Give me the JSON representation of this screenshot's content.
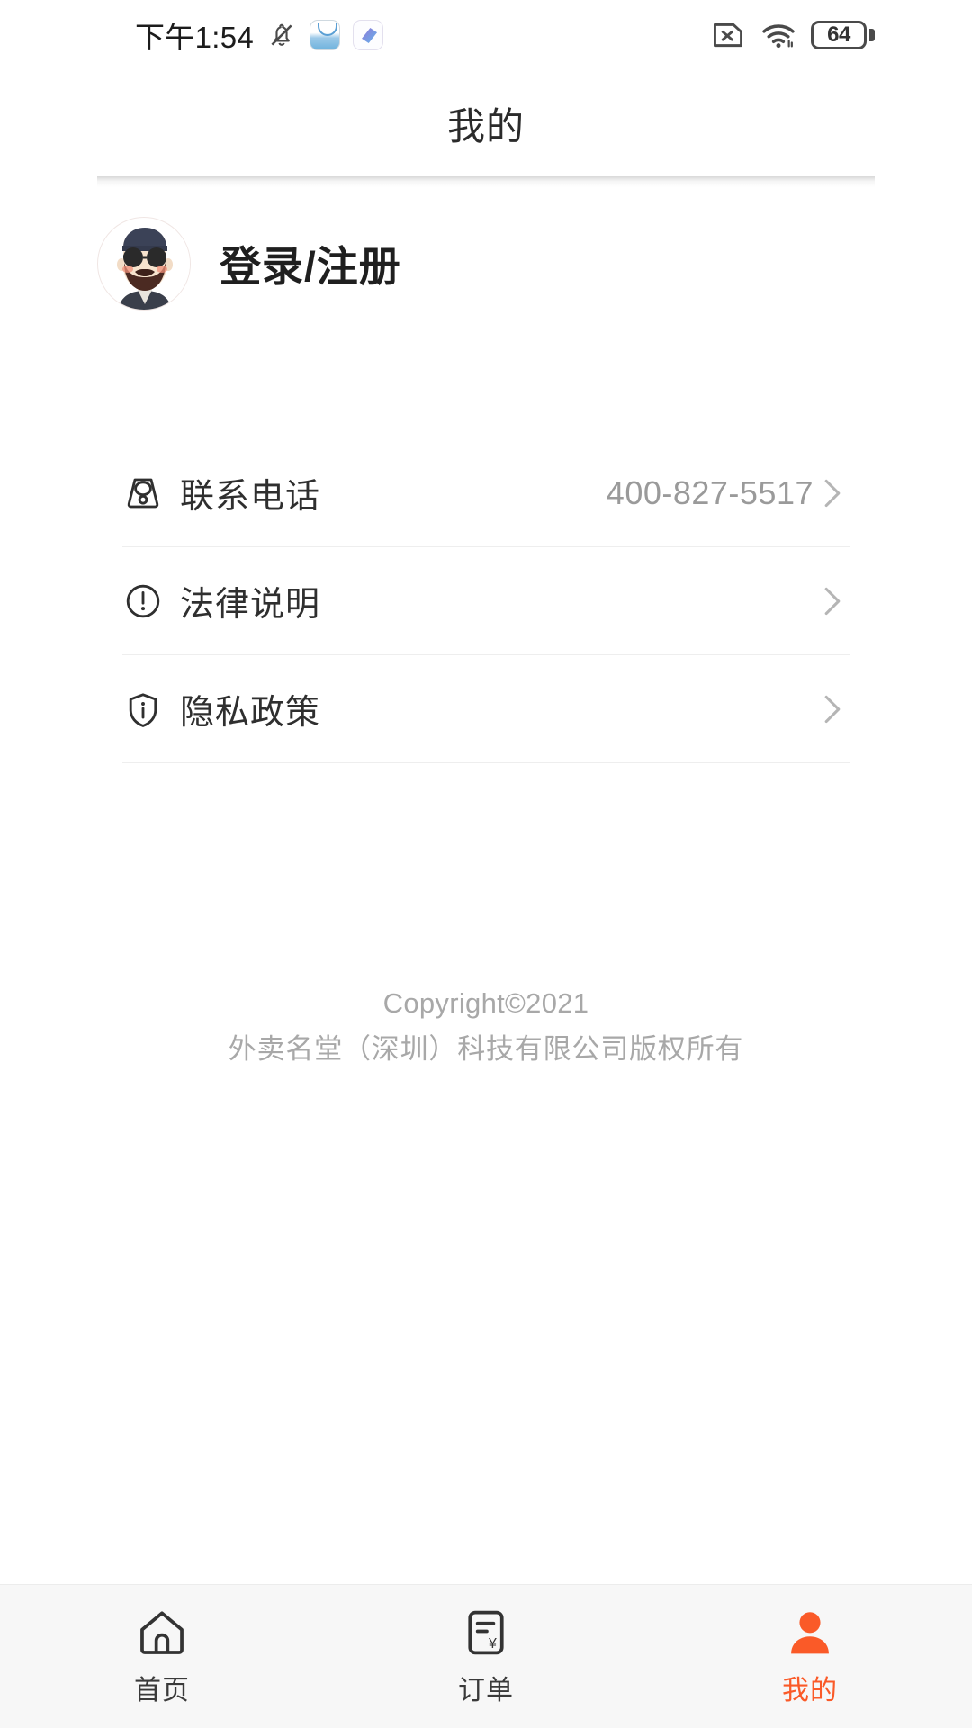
{
  "status_bar": {
    "time": "下午1:54",
    "bell_icon": "bell-muted-icon",
    "app_icon_1": "app-shortcut-icon",
    "app_icon_2": "app-shortcut-icon",
    "no_sim_icon": "no-sim-icon",
    "wifi_icon": "wifi-icon",
    "battery_level": "64"
  },
  "header": {
    "title": "我的"
  },
  "profile": {
    "avatar_icon": "user-avatar",
    "name": "登录/注册"
  },
  "menu": {
    "items": [
      {
        "icon": "telephone-icon",
        "label": "联系电话",
        "value": "400-827-5517",
        "chevron": "chevron-right-icon"
      },
      {
        "icon": "exclamation-circle-icon",
        "label": "法律说明",
        "value": "",
        "chevron": "chevron-right-icon"
      },
      {
        "icon": "shield-info-icon",
        "label": "隐私政策",
        "value": "",
        "chevron": "chevron-right-icon"
      }
    ]
  },
  "footer": {
    "line1": "Copyright©2021",
    "line2": "外卖名堂（深圳）科技有限公司版权所有"
  },
  "tabbar": {
    "active_color": "#fa5a28",
    "inactive_color": "#3a3a3a",
    "items": [
      {
        "icon": "home-icon",
        "label": "首页",
        "active": false
      },
      {
        "icon": "order-receipt-icon",
        "label": "订单",
        "active": false
      },
      {
        "icon": "person-icon",
        "label": "我的",
        "active": true
      }
    ]
  }
}
